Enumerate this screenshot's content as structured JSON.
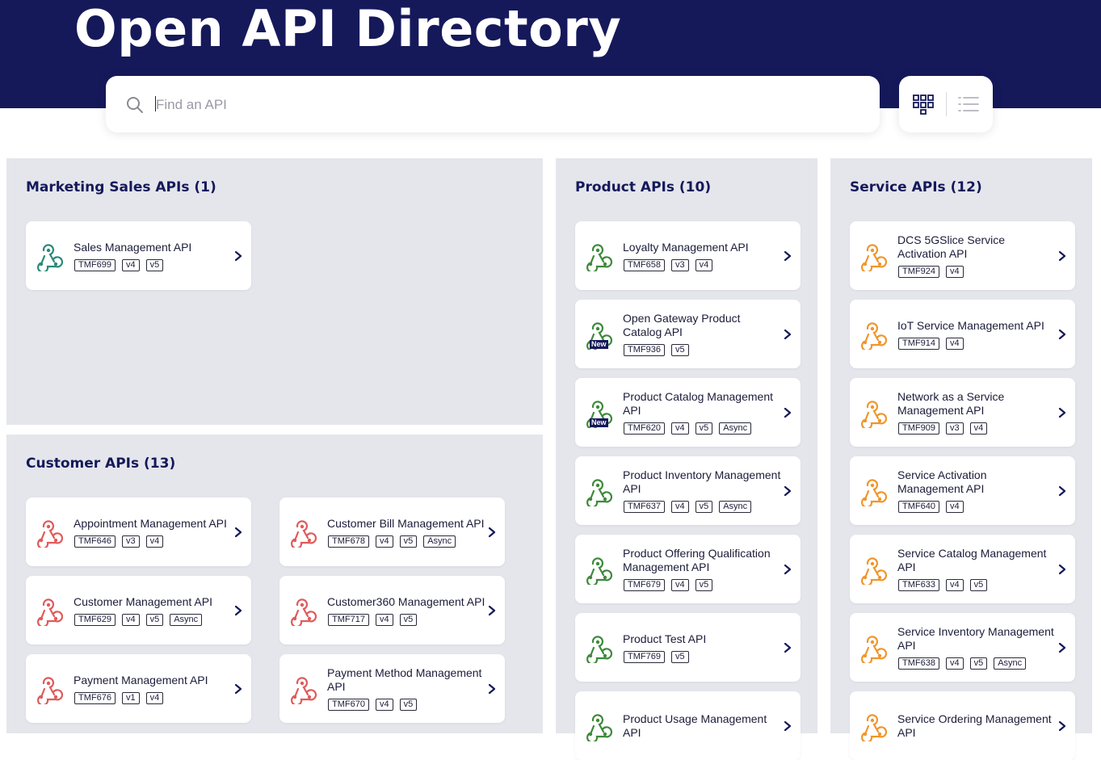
{
  "header": {
    "title": "Open API Directory"
  },
  "search": {
    "placeholder": "Find an API",
    "value": ""
  },
  "view_toggle": {
    "options": [
      "grid-view",
      "list-view"
    ],
    "selected": "grid-view"
  },
  "colors": {
    "hero_bg": "#15195a",
    "panel_bg": "#e5e6ec",
    "marketing_icon": "#2a8a78",
    "customer_icon": "#e05a5a",
    "product_icon": "#3d8a3a",
    "service_icon": "#f0962a"
  },
  "groups": [
    {
      "id": "marketing",
      "title": "Marketing Sales APIs (1)",
      "icon": "webhook-icon",
      "cards": [
        {
          "name": "Sales Management API",
          "tags": [
            "TMF699",
            "v4",
            "v5"
          ],
          "is_new": false
        }
      ]
    },
    {
      "id": "customer",
      "title": "Customer APIs (13)",
      "icon": "webhook-icon",
      "cards": [
        {
          "name": "Appointment Management API",
          "tags": [
            "TMF646",
            "v3",
            "v4"
          ],
          "is_new": false
        },
        {
          "name": "Customer Bill Management API",
          "tags": [
            "TMF678",
            "v4",
            "v5",
            "Async"
          ],
          "is_new": false
        },
        {
          "name": "Customer Management API",
          "tags": [
            "TMF629",
            "v4",
            "v5",
            "Async"
          ],
          "is_new": false
        },
        {
          "name": "Customer360 Management API",
          "tags": [
            "TMF717",
            "v4",
            "v5"
          ],
          "is_new": false
        },
        {
          "name": "Payment Management API",
          "tags": [
            "TMF676",
            "v1",
            "v4"
          ],
          "is_new": false
        },
        {
          "name": "Payment Method Management API",
          "tags": [
            "TMF670",
            "v4",
            "v5"
          ],
          "is_new": false
        }
      ]
    },
    {
      "id": "product",
      "title": "Product APIs (10)",
      "icon": "webhook-icon",
      "cards": [
        {
          "name": "Loyalty Management API",
          "tags": [
            "TMF658",
            "v3",
            "v4"
          ],
          "is_new": false
        },
        {
          "name": "Open Gateway Product Catalog API",
          "tags": [
            "TMF936",
            "v5"
          ],
          "is_new": true
        },
        {
          "name": "Product Catalog Management API",
          "tags": [
            "TMF620",
            "v4",
            "v5",
            "Async"
          ],
          "is_new": true
        },
        {
          "name": "Product Inventory Management API",
          "tags": [
            "TMF637",
            "v4",
            "v5",
            "Async"
          ],
          "is_new": false
        },
        {
          "name": "Product Offering Qualification Management API",
          "tags": [
            "TMF679",
            "v4",
            "v5"
          ],
          "is_new": false
        },
        {
          "name": "Product Test API",
          "tags": [
            "TMF769",
            "v5"
          ],
          "is_new": false
        },
        {
          "name": "Product Usage Management API",
          "tags": [],
          "is_new": false
        }
      ]
    },
    {
      "id": "service",
      "title": "Service APIs (12)",
      "icon": "webhook-icon",
      "cards": [
        {
          "name": "DCS 5GSlice Service Activation API",
          "tags": [
            "TMF924",
            "v4"
          ],
          "is_new": false
        },
        {
          "name": "IoT Service Management API",
          "tags": [
            "TMF914",
            "v4"
          ],
          "is_new": false
        },
        {
          "name": "Network as a Service Management API",
          "tags": [
            "TMF909",
            "v3",
            "v4"
          ],
          "is_new": false
        },
        {
          "name": "Service Activation Management API",
          "tags": [
            "TMF640",
            "v4"
          ],
          "is_new": false
        },
        {
          "name": "Service Catalog Management API",
          "tags": [
            "TMF633",
            "v4",
            "v5"
          ],
          "is_new": false
        },
        {
          "name": "Service Inventory Management API",
          "tags": [
            "TMF638",
            "v4",
            "v5",
            "Async"
          ],
          "is_new": false
        },
        {
          "name": "Service Ordering Management API",
          "tags": [],
          "is_new": false
        }
      ]
    }
  ],
  "new_badge_label": "New"
}
